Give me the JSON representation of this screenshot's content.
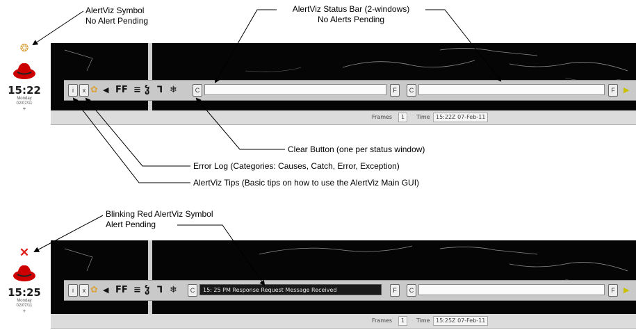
{
  "annotations": {
    "symbol_no_alert": [
      "AlertViz Symbol",
      "No Alert Pending"
    ],
    "status_bar": [
      "AlertViz Status Bar (2-windows)",
      "No Alerts Pending"
    ],
    "clear_button": "Clear Button (one per status window)",
    "error_log": "Error Log (Categories: Causes, Catch, Error, Exception)",
    "tips": "AlertViz Tips (Basic tips on how to use the AlertViz Main GUI)",
    "symbol_alert": [
      "Blinking Red AlertViz Symbol",
      "Alert Pending"
    ]
  },
  "panel_top": {
    "clock": "15:22",
    "day": "Monday",
    "date": "02/07/11",
    "frames_label": "Frames",
    "frames_value": "1",
    "time_label": "Time",
    "time_value": "15:22Z 07-Feb-11",
    "status_left": "",
    "status_right": ""
  },
  "panel_bottom": {
    "clock": "15:25",
    "day": "Monday",
    "date": "02/07/11",
    "frames_label": "Frames",
    "frames_value": "1",
    "time_label": "Time",
    "time_value": "15:25Z 07-Feb-11",
    "status_left": "15: 25 PM Response Request Message Received",
    "status_right": ""
  },
  "toolbar": {
    "icon_tips": "i",
    "icon_error_log": "x",
    "icon_font": "FF",
    "icon_menu": "≡",
    "icon_tools": "ჴ",
    "icon_bracket": "ʃ",
    "icon_snow": "❄",
    "clear_label": "C",
    "filter_label": "F"
  },
  "colors": {
    "symbol_no_alert": "#d9a441",
    "symbol_alert": "#e0201b",
    "redhat_red": "#cc0000",
    "map_bg": "#050505",
    "coast": "#9a9a9a"
  }
}
